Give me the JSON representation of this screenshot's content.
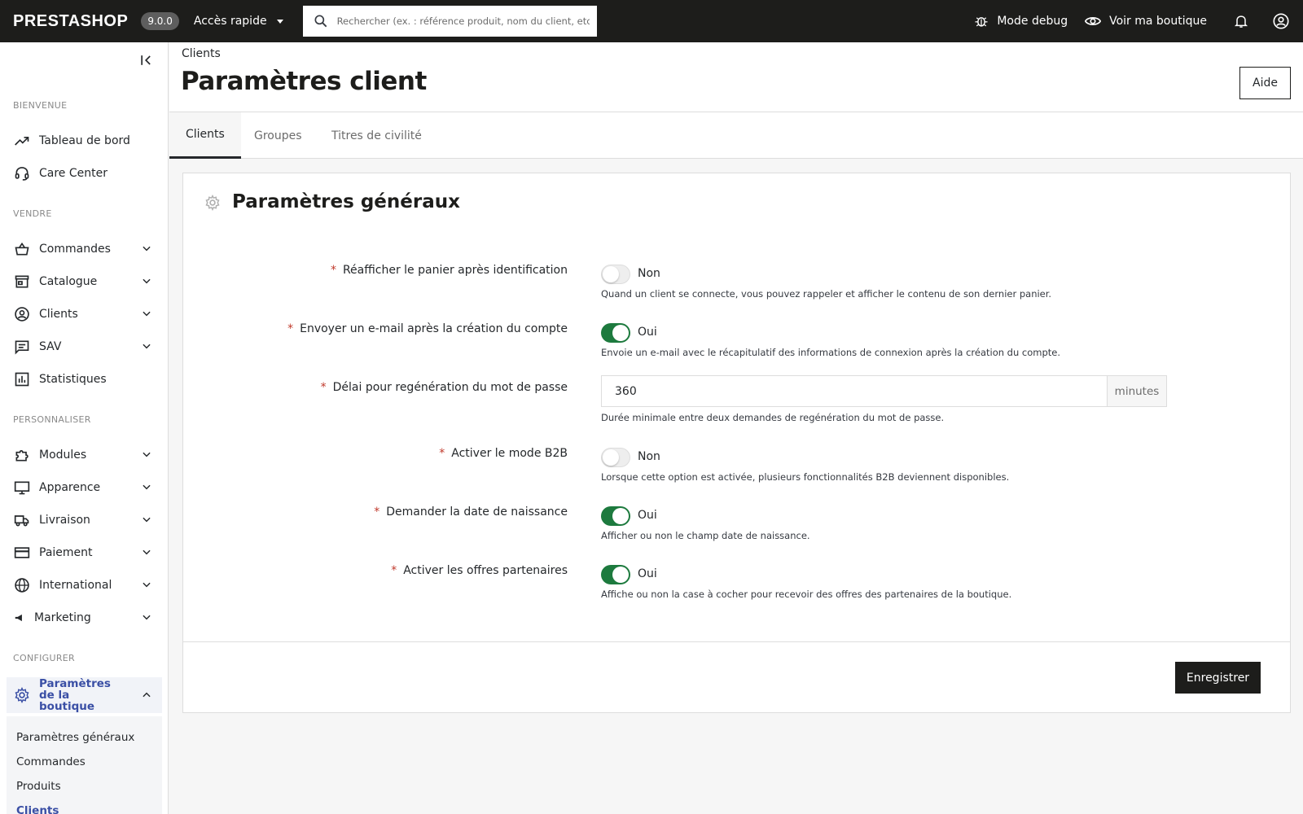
{
  "header": {
    "logo": "PRESTASHOP",
    "version": "9.0.0",
    "quick_access": "Accès rapide",
    "search_placeholder": "Rechercher (ex. : référence produit, nom du client, etc.)",
    "debug_label": "Mode debug",
    "shop_label": "Voir ma boutique"
  },
  "sidebar": {
    "sections": {
      "welcome": "BIENVENUE",
      "sell": "VENDRE",
      "customize": "PERSONNALISER",
      "configure": "CONFIGURER"
    },
    "welcome_items": [
      {
        "label": "Tableau de bord",
        "icon": "trending-up-icon"
      },
      {
        "label": "Care Center",
        "icon": "headset-icon"
      }
    ],
    "sell_items": [
      {
        "label": "Commandes",
        "icon": "basket-icon"
      },
      {
        "label": "Catalogue",
        "icon": "store-icon"
      },
      {
        "label": "Clients",
        "icon": "account-circle-icon"
      },
      {
        "label": "SAV",
        "icon": "chat-icon"
      },
      {
        "label": "Statistiques",
        "icon": "bar-chart-icon"
      }
    ],
    "customize_items": [
      {
        "label": "Modules",
        "icon": "puzzle-icon"
      },
      {
        "label": "Apparence",
        "icon": "monitor-icon"
      },
      {
        "label": "Livraison",
        "icon": "truck-icon"
      },
      {
        "label": "Paiement",
        "icon": "credit-card-icon"
      },
      {
        "label": "International",
        "icon": "globe-icon"
      },
      {
        "label": "Marketing",
        "icon": "megaphone-icon"
      }
    ],
    "configure_active": "Paramètres de la boutique",
    "configure_sub": [
      "Paramètres généraux",
      "Commandes",
      "Produits",
      "Clients"
    ]
  },
  "page": {
    "breadcrumb": "Clients",
    "title": "Paramètres client",
    "help_button": "Aide",
    "tabs": [
      "Clients",
      "Groupes",
      "Titres de civilité"
    ]
  },
  "card": {
    "title": "Paramètres généraux",
    "rows": [
      {
        "label": "Réafficher le panier après identification",
        "state": "Non",
        "on": false,
        "help": "Quand un client se connecte, vous pouvez rappeler et afficher le contenu de son dernier panier."
      },
      {
        "label": "Envoyer un e-mail après la création du compte",
        "state": "Oui",
        "on": true,
        "help": "Envoie un e-mail avec le récapitulatif des informations de connexion après la création du compte."
      },
      {
        "label": "Délai pour regénération du mot de passe",
        "value": "360",
        "unit": "minutes",
        "help": "Durée minimale entre deux demandes de regénération du mot de passe."
      },
      {
        "label": "Activer le mode B2B",
        "state": "Non",
        "on": false,
        "help": "Lorsque cette option est activée, plusieurs fonctionnalités B2B deviennent disponibles."
      },
      {
        "label": "Demander la date de naissance",
        "state": "Oui",
        "on": true,
        "help": "Afficher ou non le champ date de naissance."
      },
      {
        "label": "Activer les offres partenaires",
        "state": "Oui",
        "on": true,
        "help": "Affiche ou non la case à cocher pour recevoir des offres des partenaires de la boutique."
      }
    ],
    "save_button": "Enregistrer"
  },
  "colors": {
    "topbar": "#1d1d1b",
    "toggle_on": "#1d7a3e",
    "active_nav": "#3a4fa5",
    "required": "#c0392b"
  }
}
